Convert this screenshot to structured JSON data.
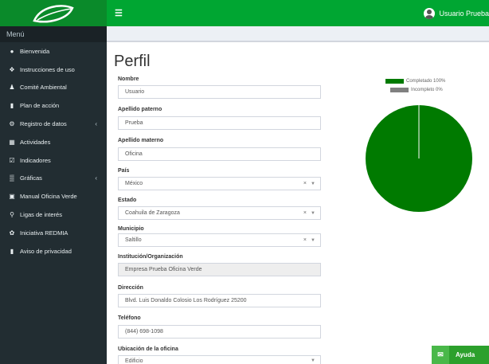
{
  "header": {
    "user_name": "Usuario Prueba"
  },
  "sidebar": {
    "title": "Menú",
    "items": [
      {
        "label": "Bienvenida"
      },
      {
        "label": "Instrucciones de uso"
      },
      {
        "label": "Comité Ambiental"
      },
      {
        "label": "Plan de acción"
      },
      {
        "label": "Registro de datos"
      },
      {
        "label": "Actividades"
      },
      {
        "label": "Indicadores"
      },
      {
        "label": "Gráficas"
      },
      {
        "label": "Manual Oficina Verde"
      },
      {
        "label": "Ligas de interés"
      },
      {
        "label": "Iniciativa REDMIA"
      },
      {
        "label": "Aviso de privacidad"
      }
    ]
  },
  "profile": {
    "title": "Perfil",
    "nombre_label": "Nombre",
    "nombre_value": "Usuario",
    "paterno_label": "Apellido paterno",
    "paterno_value": "Prueba",
    "materno_label": "Apellido materno",
    "materno_value": "Oficina",
    "pais_label": "País",
    "pais_value": "México",
    "estado_label": "Estado",
    "estado_value": "Coahuila de Zaragoza",
    "municipio_label": "Municipio",
    "municipio_value": "Saltillo",
    "institucion_label": "Institución/Organización",
    "institucion_value": "Empresa Prueba Oficina Verde",
    "direccion_label": "Dirección",
    "direccion_value": "Blvd. Luis Donaldo Colosio Los Rodríguez 25200",
    "telefono_label": "Teléfono",
    "telefono_value": "(844) 698-1098",
    "ubicacion_label": "Ubicación de la oficina",
    "ubicacion_value": "Edificio"
  },
  "chart_data": {
    "type": "pie",
    "categories": [
      "Completado 100%",
      "Incompleto 0%"
    ],
    "values": [
      100,
      0
    ],
    "colors": [
      "#007a00",
      "#808080"
    ],
    "legend_position": "top"
  },
  "help": {
    "label": "Ayuda"
  },
  "colors": {
    "topbar": "#00a632",
    "sidebar": "#222d32",
    "completed": "#007a00",
    "incomplete": "#808080"
  }
}
